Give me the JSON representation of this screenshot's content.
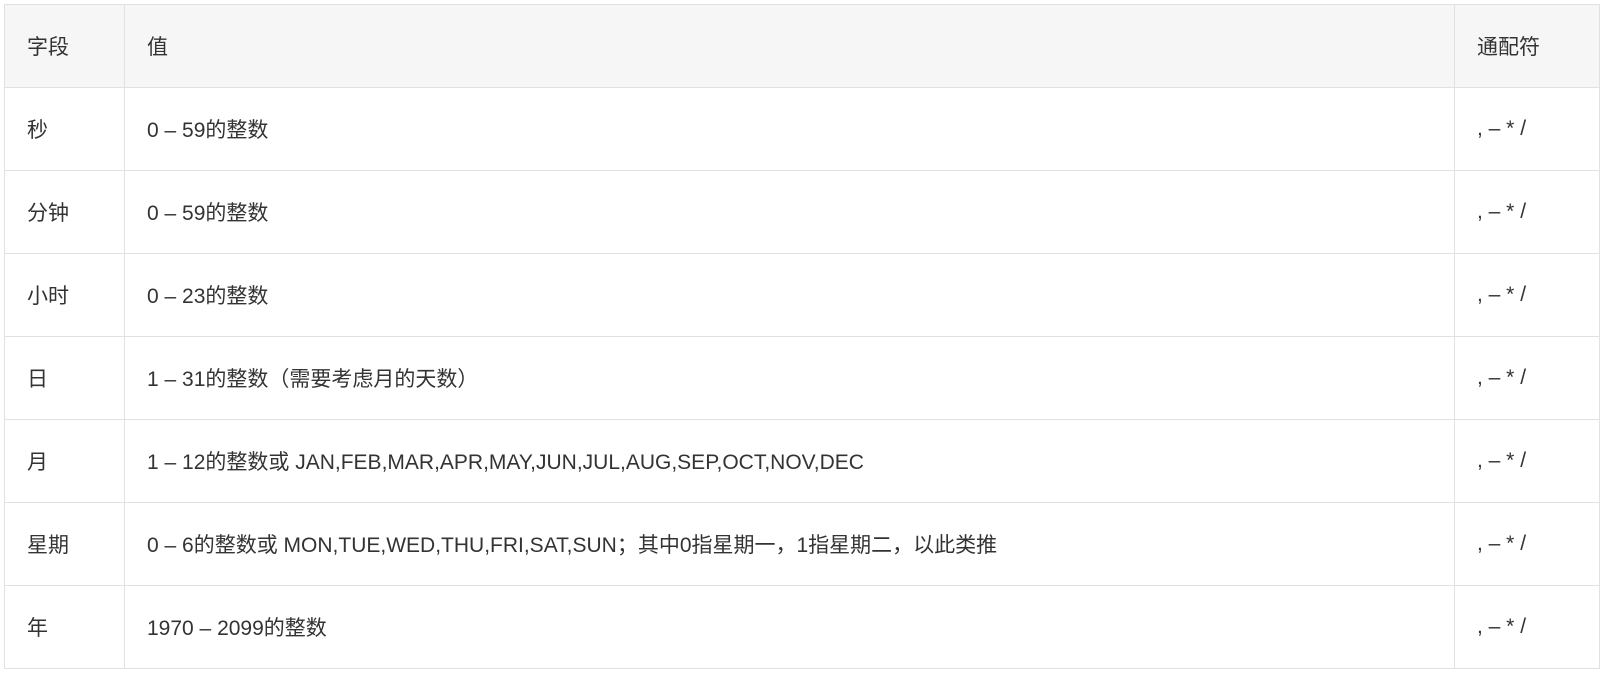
{
  "table": {
    "headers": {
      "field": "字段",
      "value": "值",
      "wildcard": "通配符"
    },
    "rows": [
      {
        "field": "秒",
        "value": "0 – 59的整数",
        "wildcard": ", – * /"
      },
      {
        "field": "分钟",
        "value": "0 – 59的整数",
        "wildcard": ", – * /"
      },
      {
        "field": "小时",
        "value": "0 – 23的整数",
        "wildcard": ", – * /"
      },
      {
        "field": "日",
        "value": "1 – 31的整数（需要考虑月的天数）",
        "wildcard": ", – * /"
      },
      {
        "field": "月",
        "value": "1 – 12的整数或 JAN,FEB,MAR,APR,MAY,JUN,JUL,AUG,SEP,OCT,NOV,DEC",
        "wildcard": ", – * /"
      },
      {
        "field": "星期",
        "value": "0 – 6的整数或 MON,TUE,WED,THU,FRI,SAT,SUN；其中0指星期一，1指星期二，以此类推",
        "wildcard": ", – * /"
      },
      {
        "field": "年",
        "value": "1970 – 2099的整数",
        "wildcard": ", – * /"
      }
    ]
  }
}
